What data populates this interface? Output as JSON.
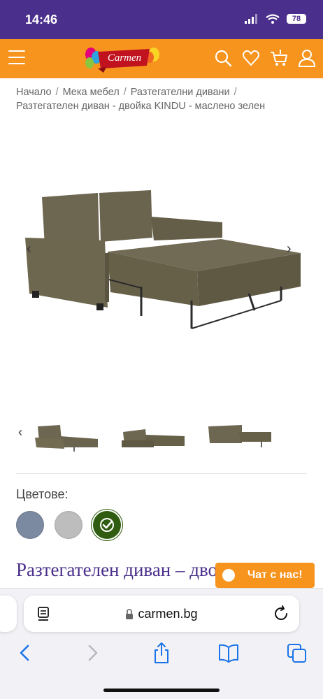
{
  "status_bar": {
    "time": "14:46",
    "battery": "78"
  },
  "header": {
    "logo_text": "Carmen",
    "icons": [
      "search-icon",
      "heart-icon",
      "cart-icon",
      "user-icon"
    ],
    "brand_color": "#f7941d"
  },
  "breadcrumb": {
    "items": [
      "Начало",
      "Мека мебел",
      "Разтегателни дивани"
    ],
    "separator": "/",
    "current": "Разтегателен диван - двойка KINDU - маслено зелен"
  },
  "gallery": {
    "prev": "‹",
    "next": "›",
    "thumb_count": 3
  },
  "colors": {
    "label": "Цветове:",
    "swatches": [
      "#7b8aa0",
      "#bdbdbd",
      "#2f5c10"
    ],
    "selected_index": 2
  },
  "product": {
    "title": "Разтегателен диван – двойка KINDU"
  },
  "chat": {
    "label": "Чат с нас!"
  },
  "browser": {
    "url": "carmen.bg",
    "nav_icons": [
      "back-icon",
      "forward-icon",
      "share-icon",
      "bookmarks-icon",
      "tabs-icon"
    ]
  }
}
